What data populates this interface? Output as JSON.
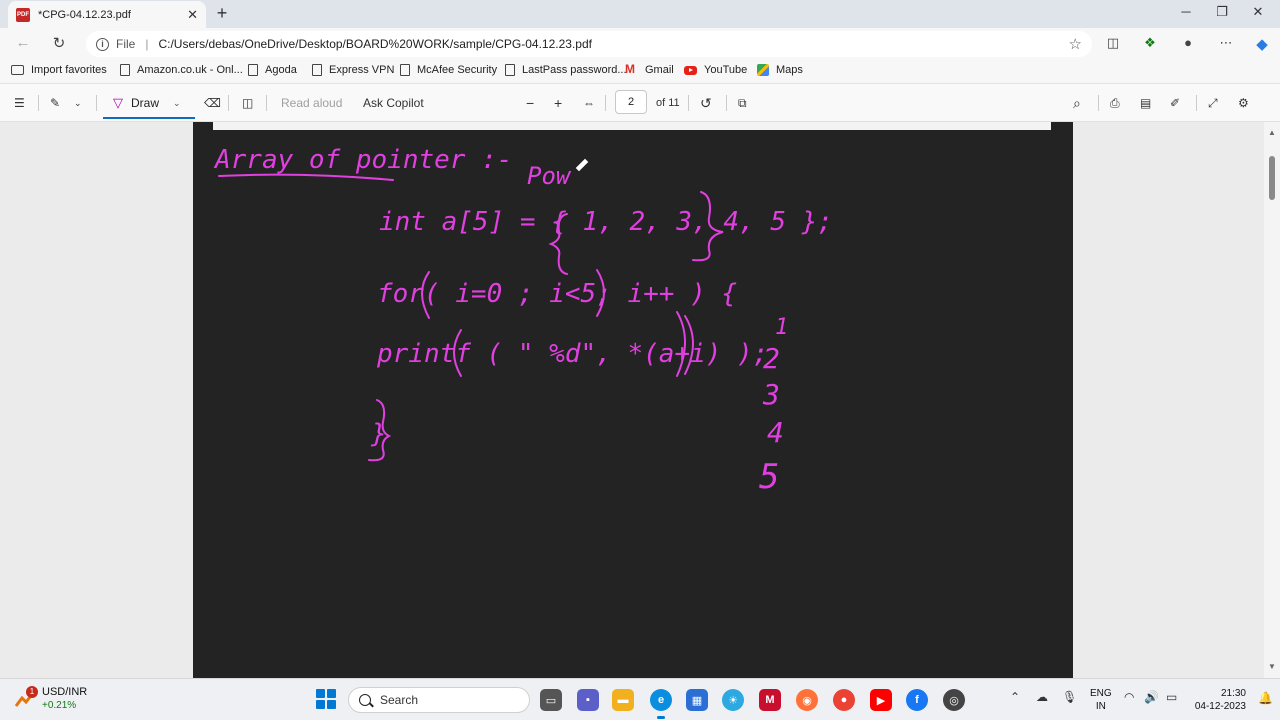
{
  "tab": {
    "title": "*CPG-04.12.23.pdf",
    "badge": "PDF"
  },
  "address": {
    "scheme_label": "File",
    "url": "C:/Users/debas/OneDrive/Desktop/BOARD%20WORK/sample/CPG-04.12.23.pdf"
  },
  "favorites": [
    {
      "label": "Import favorites",
      "icon": "folder-icon"
    },
    {
      "label": "Amazon.co.uk - Onl...",
      "icon": "doc-icon"
    },
    {
      "label": "Agoda",
      "icon": "doc-icon"
    },
    {
      "label": "Express VPN",
      "icon": "doc-icon"
    },
    {
      "label": "McAfee Security",
      "icon": "doc-icon"
    },
    {
      "label": "LastPass password...",
      "icon": "doc-icon"
    },
    {
      "label": "Gmail",
      "icon": "gmail-icon"
    },
    {
      "label": "YouTube",
      "icon": "youtube-icon"
    },
    {
      "label": "Maps",
      "icon": "maps-icon"
    }
  ],
  "pdf_toolbar": {
    "draw": "Draw",
    "read_aloud": "Read aloud",
    "ask_copilot": "Ask Copilot",
    "page_current": "2",
    "page_total": "of 11"
  },
  "handwriting": {
    "heading": "Array of pointer :-",
    "side_note": "Pow",
    "line1": "int a[5] = { 1, 2, 3, 4, 5 };",
    "line2": "for( i=0 ; i<5; i++ ) {",
    "line3": "printf ( \" %d\", *(a+i) );",
    "line4": "}",
    "output": [
      "1",
      "2",
      "3",
      "4",
      "5"
    ],
    "ink_color": "#e040e0"
  },
  "taskbar": {
    "weather_name": "USD/INR",
    "weather_value": "+0.21%",
    "weather_badge": "1",
    "search_label": "Search",
    "lang_top": "ENG",
    "lang_bottom": "IN",
    "time": "21:30",
    "date": "04-12-2023"
  }
}
